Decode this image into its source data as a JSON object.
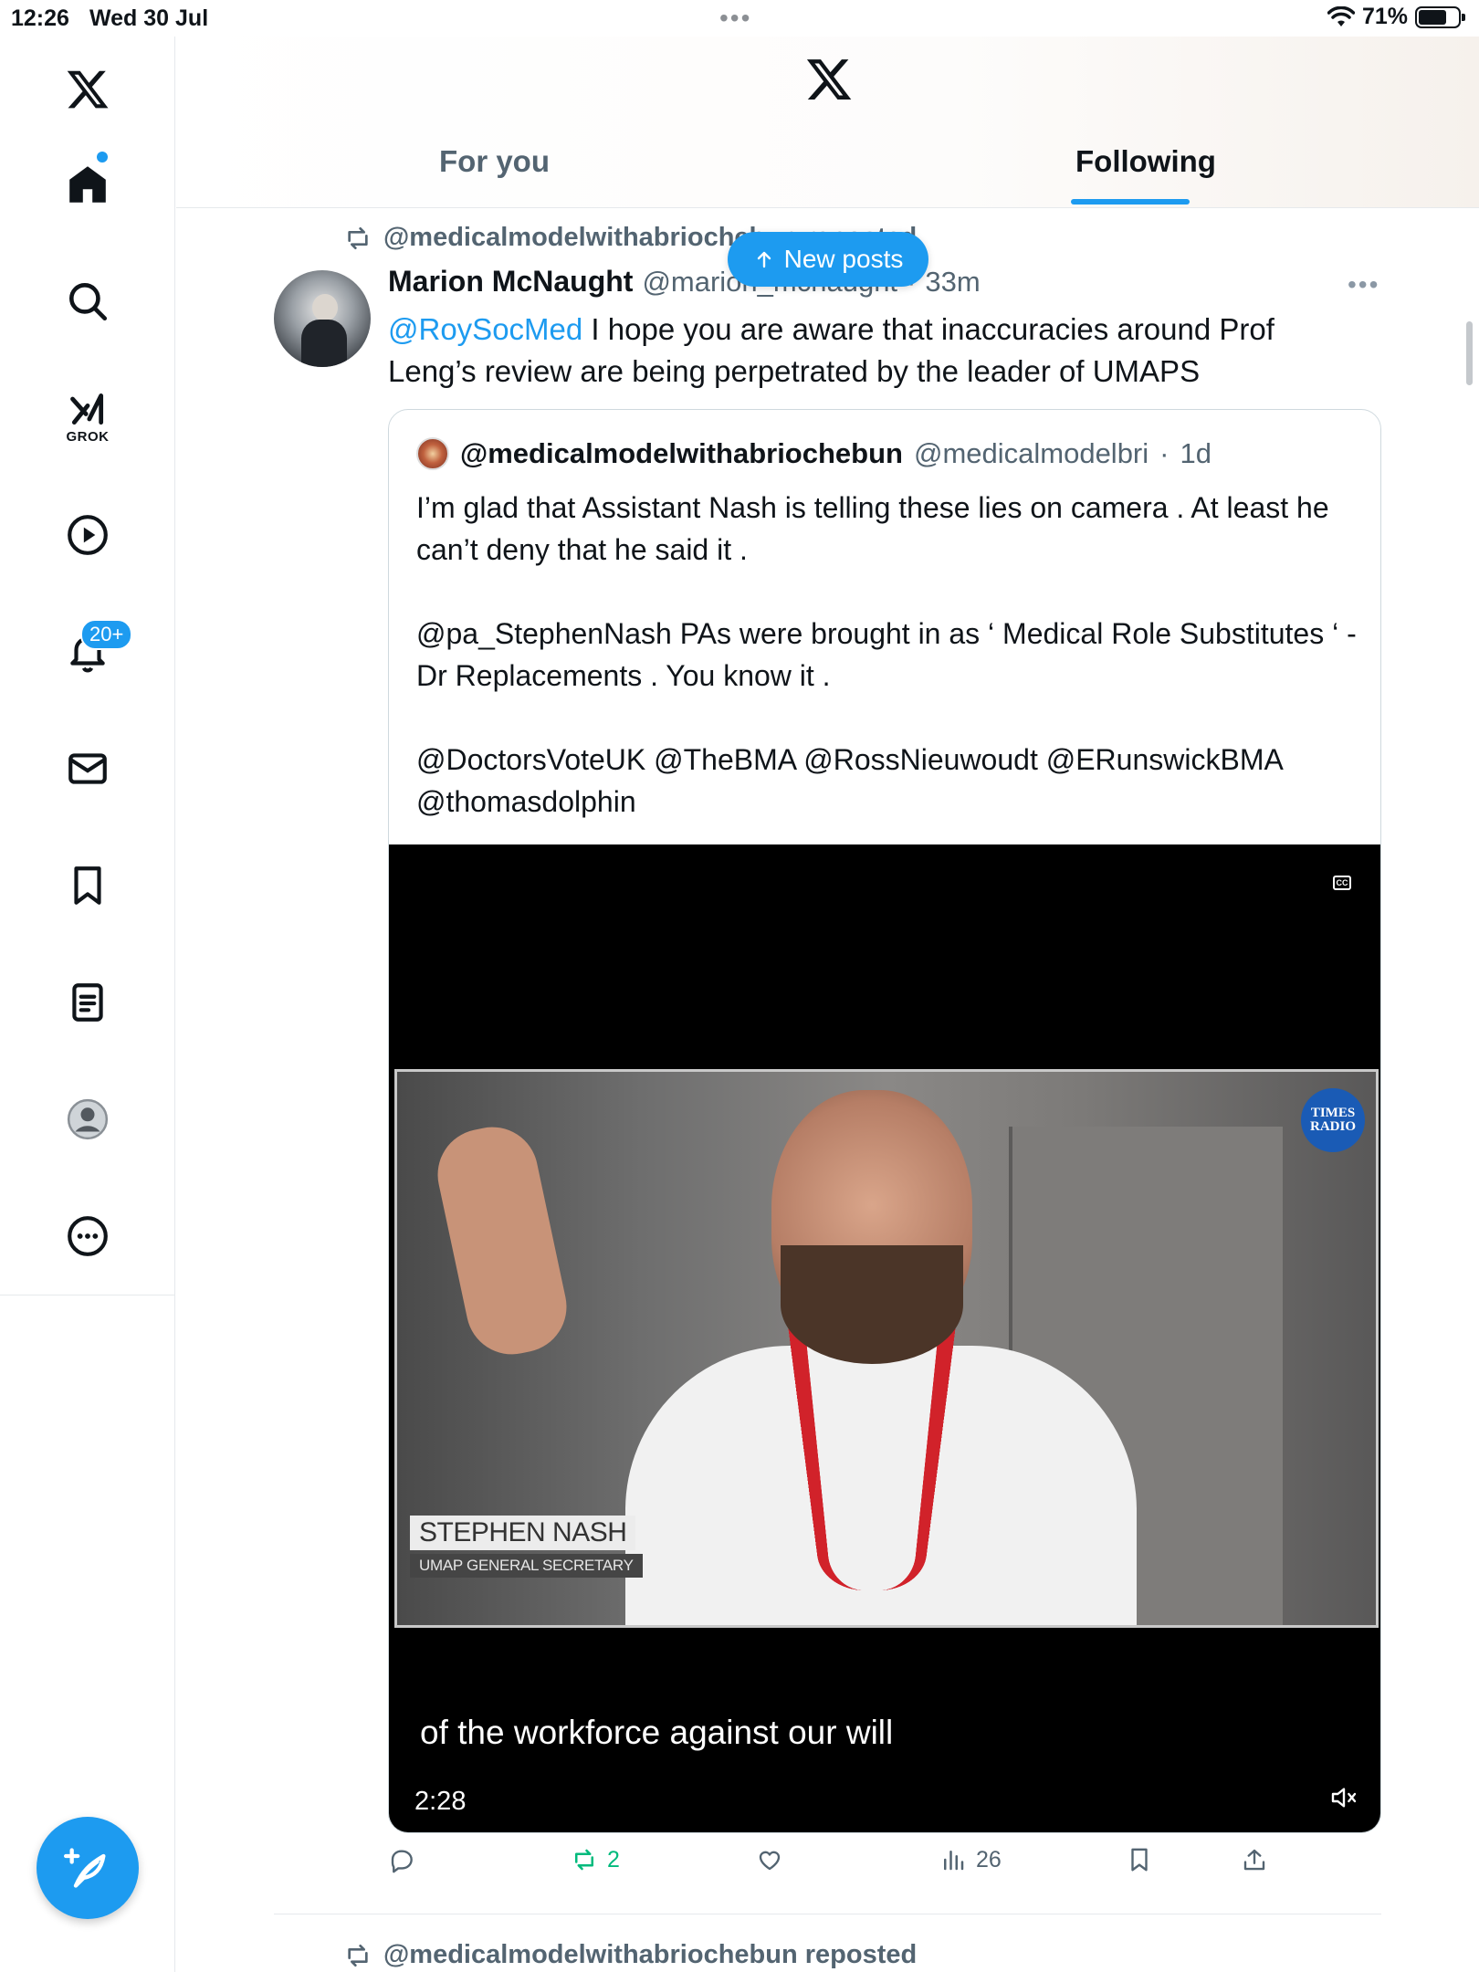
{
  "status_bar": {
    "time": "12:26",
    "date": "Wed 30 Jul",
    "battery": "71%",
    "battery_level": 0.71
  },
  "sidebar": {
    "items": [
      {
        "name": "home",
        "icon": "home-icon"
      },
      {
        "name": "explore",
        "icon": "search-icon"
      },
      {
        "name": "grok",
        "icon": "grok-icon",
        "label": "GROK"
      },
      {
        "name": "video",
        "icon": "play-icon"
      },
      {
        "name": "notifications",
        "icon": "bell-icon",
        "badge": "20+"
      },
      {
        "name": "messages",
        "icon": "mail-icon"
      },
      {
        "name": "bookmarks",
        "icon": "bookmark-icon"
      },
      {
        "name": "articles",
        "icon": "document-icon"
      },
      {
        "name": "profile",
        "icon": "profile-avatar-icon"
      },
      {
        "name": "more",
        "icon": "more-icon"
      }
    ]
  },
  "header": {
    "tabs": [
      {
        "label": "For you",
        "active": false
      },
      {
        "label": "Following",
        "active": true
      }
    ]
  },
  "new_posts": {
    "label": "New posts"
  },
  "tweet": {
    "repost_line": "@medicalmodelwithabriochebun reposted",
    "author_name": "Marion McNaught",
    "author_handle": "@marion_mcnaught",
    "separator": "·",
    "time": "33m",
    "text_mention": "@RoySocMed",
    "text_body": " I hope you are aware that inaccuracies around Prof Leng’s review are being perpetrated by the leader of UMAPS",
    "quote": {
      "name": "@medicalmodelwithabriochebun",
      "handle": "@medicalmodelbri",
      "separator": "·",
      "time": "1d",
      "paragraphs": [
        "I’m glad that Assistant Nash is telling these lies on camera . At least he can’t deny that he said it .",
        "@pa_StephenNash PAs were brought in as ‘ Medical Role Substitutes ‘ - Dr Replacements . You know it .",
        "@DoctorsVoteUK @TheBMA @RossNieuwoudt @ERunswickBMA @thomasdolphin"
      ],
      "video": {
        "cc_label": "CC",
        "broadcaster_logo": "TIMES RADIO",
        "lower_third_name": "STEPHEN NASH",
        "lower_third_role": "UMAP GENERAL SECRETARY",
        "caption": "of the workforce against our will",
        "duration": "2:28"
      }
    },
    "actions": {
      "reply_count": "",
      "repost_count": "2",
      "like_count": "",
      "views_count": "26"
    }
  },
  "next_tweet": {
    "repost_line": "@medicalmodelwithabriochebun reposted"
  },
  "colors": {
    "accent": "#1d9bf0",
    "repost_active": "#00ba7c",
    "secondary_text": "#536471"
  }
}
